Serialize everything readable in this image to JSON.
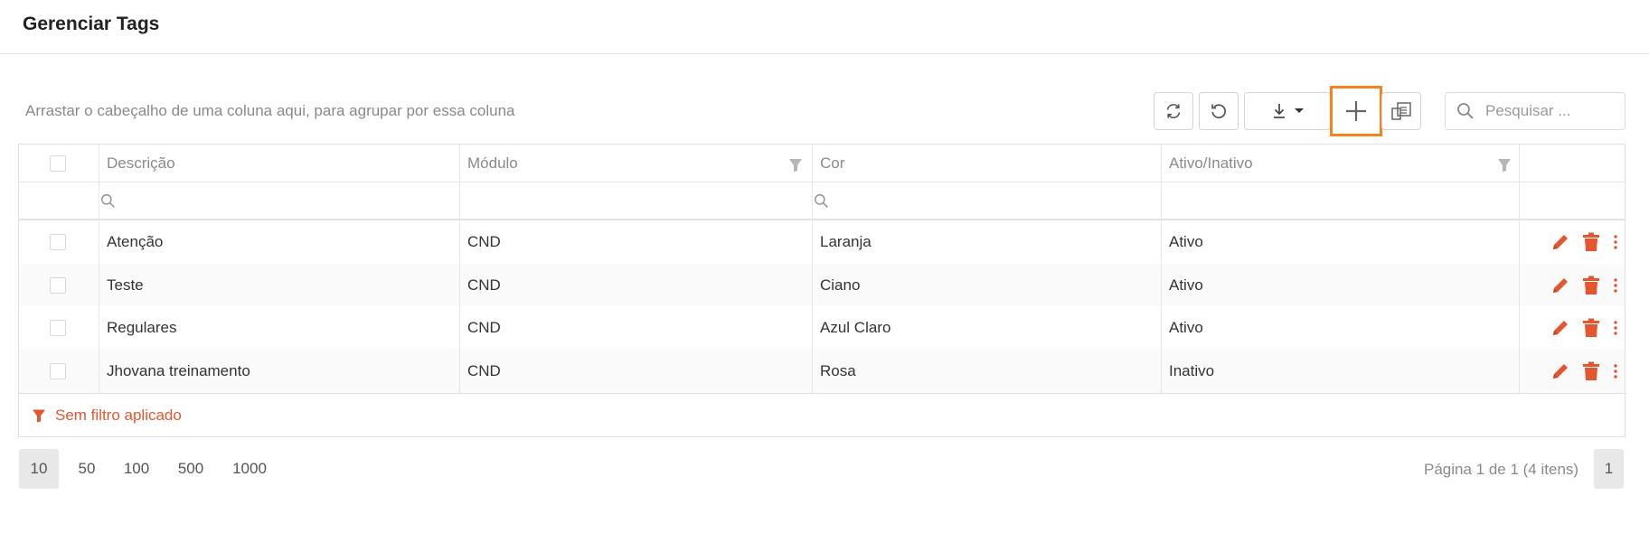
{
  "page": {
    "title": "Gerenciar Tags"
  },
  "toolbar": {
    "group_hint": "Arrastar o cabeçalho de uma coluna aqui, para agrupar por essa coluna",
    "search_placeholder": "Pesquisar ...",
    "icons": [
      "refresh-icon",
      "reset-icon",
      "download-icon",
      "add-icon",
      "column-chooser-icon",
      "search-icon"
    ]
  },
  "grid": {
    "columns": [
      "Descrição",
      "Módulo",
      "Cor",
      "Ativo/Inativo"
    ],
    "rows": [
      {
        "descricao": "Atenção",
        "modulo": "CND",
        "cor": "Laranja",
        "ativo": "Ativo"
      },
      {
        "descricao": "Teste",
        "modulo": "CND",
        "cor": "Ciano",
        "ativo": "Ativo"
      },
      {
        "descricao": "Regulares",
        "modulo": "CND",
        "cor": "Azul Claro",
        "ativo": "Ativo"
      },
      {
        "descricao": "Jhovana treinamento",
        "modulo": "CND",
        "cor": "Rosa",
        "ativo": "Inativo"
      }
    ],
    "filter_status": "Sem filtro aplicado"
  },
  "pagination": {
    "page_sizes": [
      "10",
      "50",
      "100",
      "500",
      "1000"
    ],
    "selected_size": "10",
    "info": "Página 1 de 1 (4 itens)",
    "current_page": "1"
  },
  "colors": {
    "accent": "#e4572e",
    "highlight": "#f58320"
  }
}
